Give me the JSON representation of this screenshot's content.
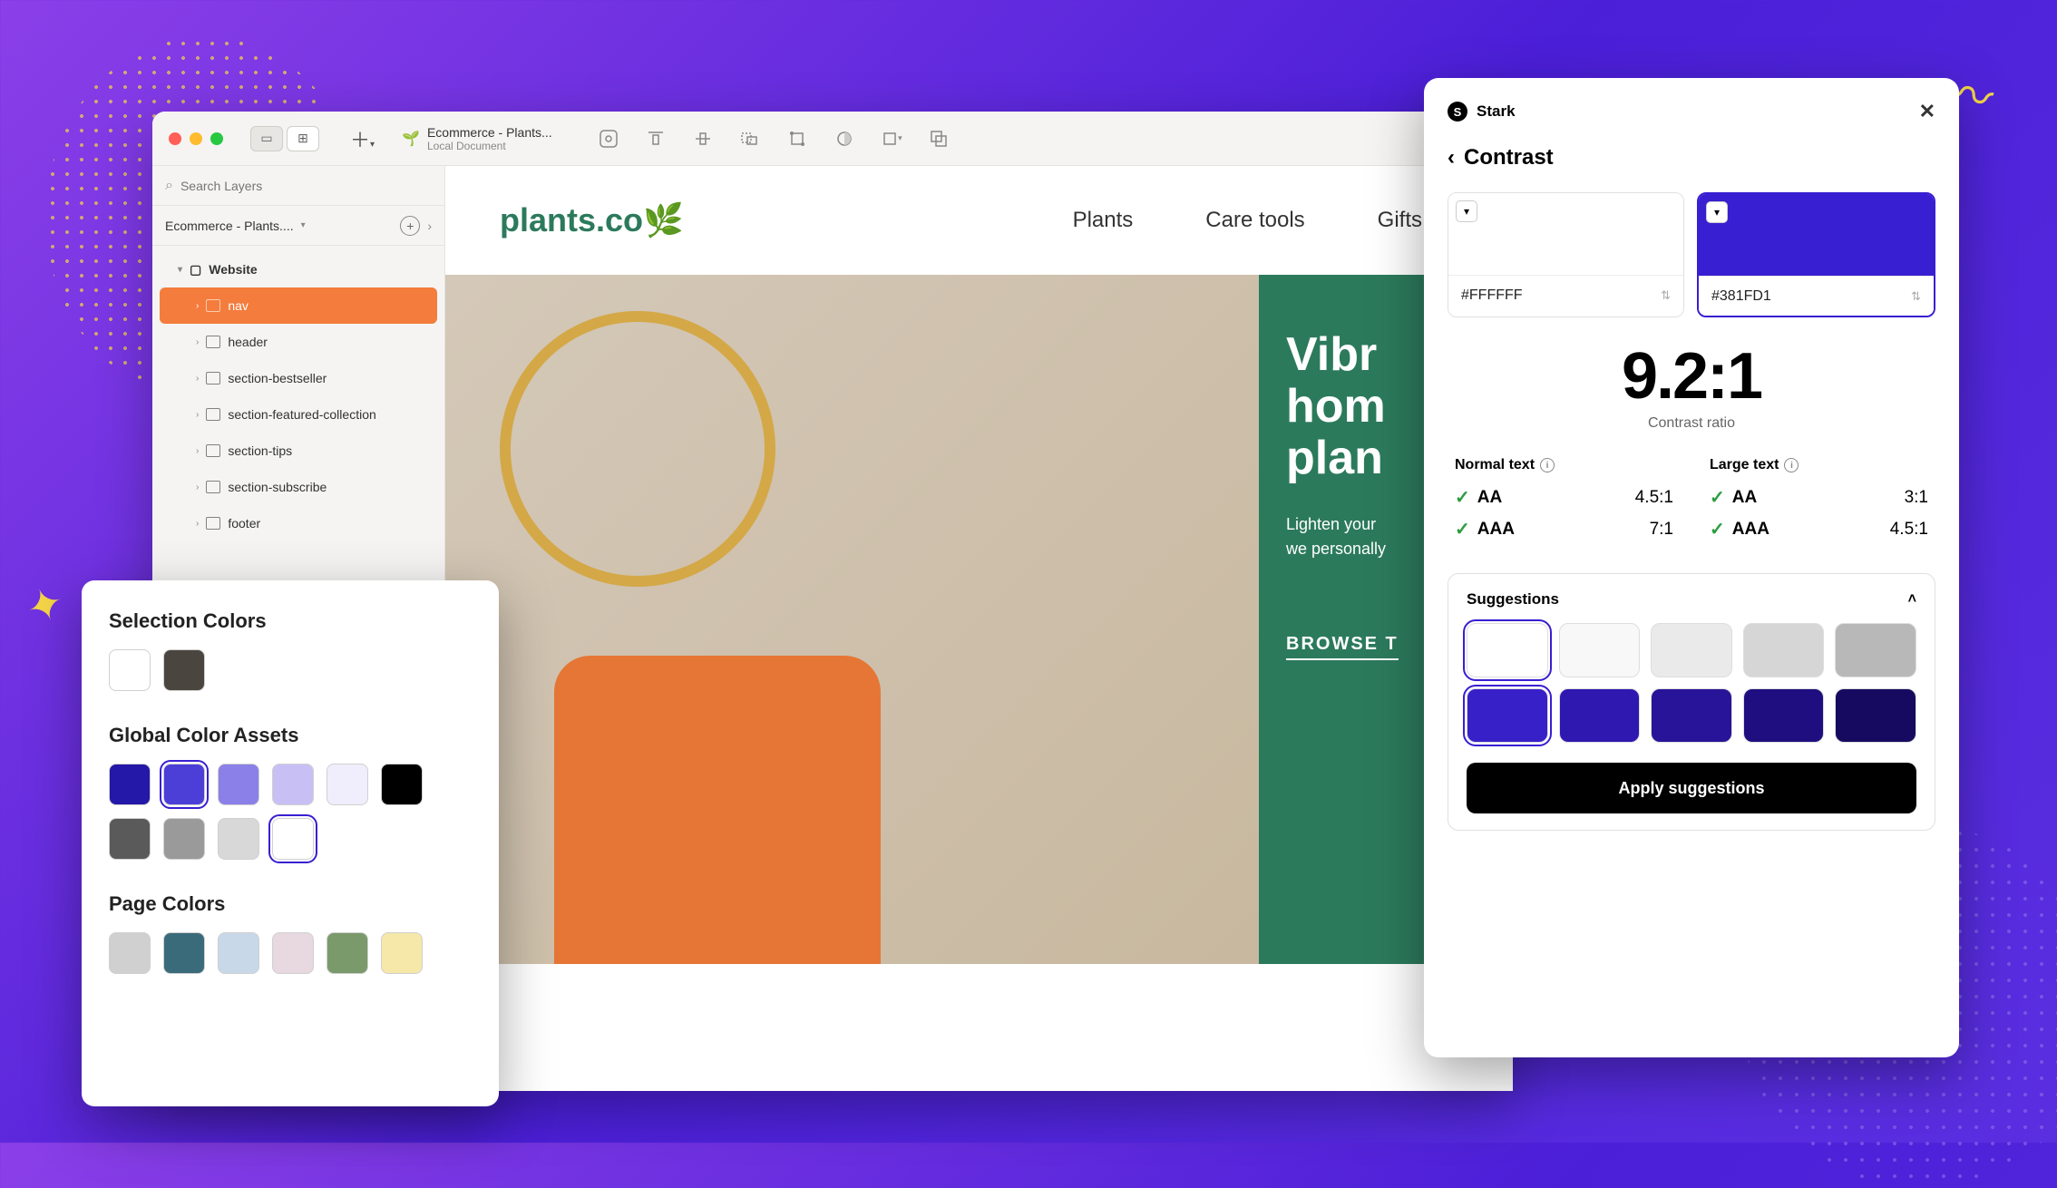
{
  "sketch": {
    "doc_name": "Ecommerce - Plants...",
    "doc_sub": "Local Document",
    "search_placeholder": "Search Layers",
    "page_name": "Ecommerce - Plants....",
    "layers": {
      "root": "Website",
      "selected": "nav",
      "items": [
        "header",
        "section-bestseller",
        "section-featured-collection",
        "section-tips",
        "section-subscribe",
        "footer"
      ]
    }
  },
  "site": {
    "logo": "plants.co",
    "nav": [
      "Plants",
      "Care tools",
      "Gifts"
    ],
    "hero_title": "Vibr\nhom\nplan",
    "hero_p": "Lighten your\nwe personally",
    "hero_link": "BROWSE T"
  },
  "colors_panel": {
    "title1": "Selection Colors",
    "sel_colors": [
      "#FFFFFF",
      "#4A453F"
    ],
    "title2": "Global Color Assets",
    "global_colors": [
      "#2418A8",
      "#4B3FD8",
      "#8B7FE8",
      "#C8C0F5",
      "#F0EEFC",
      "#000000",
      "#5A5A5A",
      "#9A9A9A",
      "#D8D8D8",
      "#FFFFFF"
    ],
    "global_selected_idx": 1,
    "global_ring_idx": 9,
    "title3": "Page Colors",
    "page_colors": [
      "#D0D0D0",
      "#3A6B7A",
      "#C8D8E8",
      "#E8D8E0",
      "#7A9A6B",
      "#F5E8A8"
    ]
  },
  "stark": {
    "brand": "Stark",
    "title": "Contrast",
    "fg_hex": "#FFFFFF",
    "fg_color": "#FFFFFF",
    "bg_hex": "#381FD1",
    "bg_color": "#381FD1",
    "ratio": "9.2:1",
    "ratio_label": "Contrast ratio",
    "normal_label": "Normal text",
    "large_label": "Large text",
    "normal_aa": "AA",
    "normal_aa_val": "4.5:1",
    "normal_aaa": "AAA",
    "normal_aaa_val": "7:1",
    "large_aa": "AA",
    "large_aa_val": "3:1",
    "large_aaa": "AAA",
    "large_aaa_val": "4.5:1",
    "suggestions_label": "Suggestions",
    "sug_top": [
      "#FFFFFF",
      "#F8F8F8",
      "#EAEAEA",
      "#D6D6D6",
      "#B8B8B8"
    ],
    "sug_bot": [
      "#3820C8",
      "#2E18B0",
      "#281498",
      "#1E0E80",
      "#160A60"
    ],
    "apply_label": "Apply suggestions"
  }
}
